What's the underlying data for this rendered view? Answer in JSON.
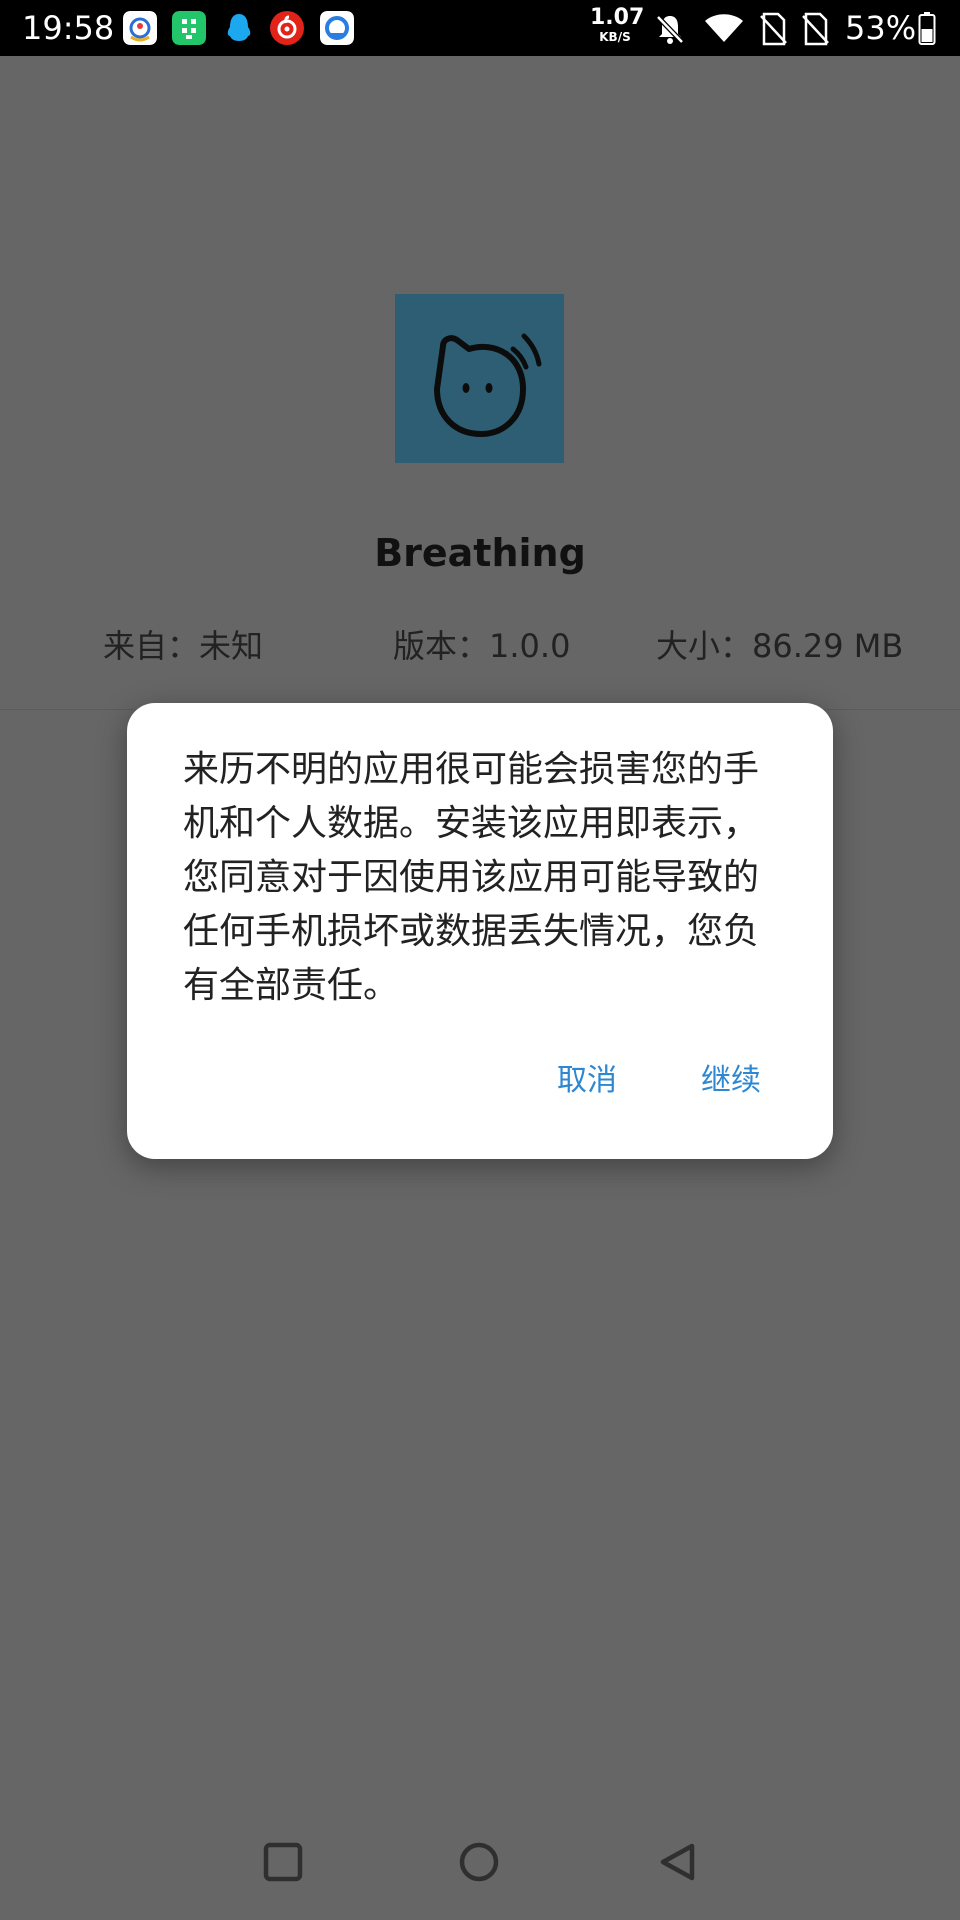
{
  "status_bar": {
    "time": "19:58",
    "notification_icons": [
      "app-notification-icon",
      "app-notification-icon",
      "qq-icon",
      "netease-music-icon",
      "browser-icon"
    ],
    "net_speed_value": "1.07",
    "net_speed_unit": "KB/S",
    "icons": [
      "bell-muted-icon",
      "wifi-icon",
      "no-sim-icon",
      "no-sim-icon",
      "battery-icon"
    ],
    "battery_percent": "53%"
  },
  "app": {
    "name": "Breathing",
    "source": "来自：未知",
    "version": "版本：1.0.0",
    "size": "大小：86.29 MB",
    "icon_color": "#2e5e73"
  },
  "dialog": {
    "message": "来历不明的应用很可能会损害您的手机和个人数据。安装该应用即表示，您同意对于因使用该应用可能导致的任何手机损坏或数据丢失情况，您负有全部责任。",
    "cancel_label": "取消",
    "continue_label": "继续",
    "accent_color": "#2d87d1"
  },
  "nav_bar": {
    "buttons": [
      "recents-button",
      "home-button",
      "back-button"
    ]
  }
}
